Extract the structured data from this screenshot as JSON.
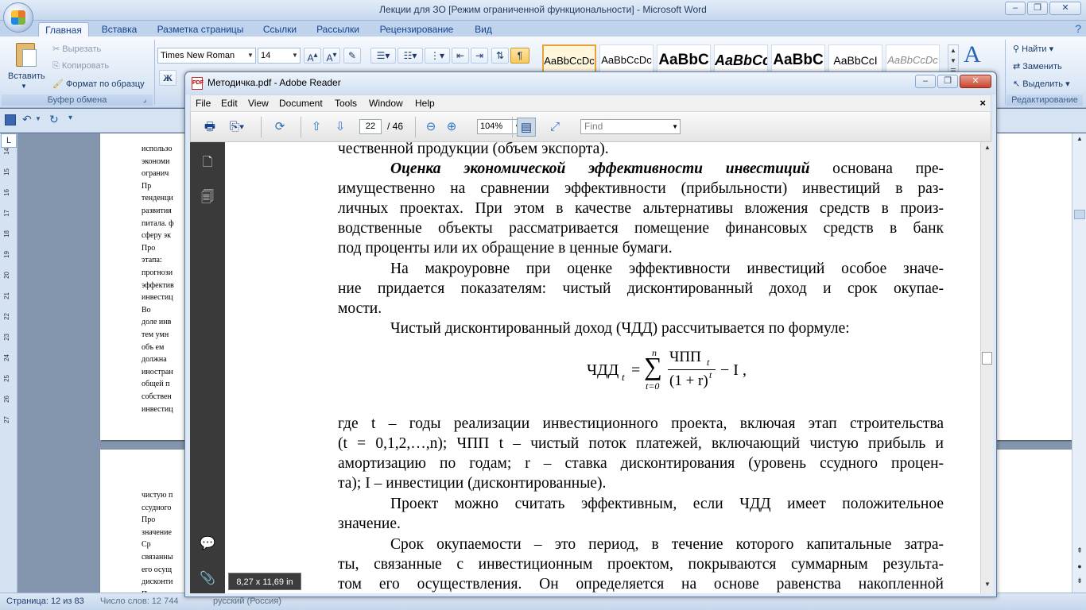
{
  "word": {
    "title": "Лекции для ЗО [Режим ограниченной функциональности] - Microsoft Word",
    "tabs": [
      "Главная",
      "Вставка",
      "Разметка страницы",
      "Ссылки",
      "Рассылки",
      "Рецензирование",
      "Вид"
    ],
    "clipboard": {
      "paste": "Вставить",
      "cut": "Вырезать",
      "copy": "Копировать",
      "format_painter": "Формат по образцу",
      "group_label": "Буфер обмена"
    },
    "font": {
      "name": "Times New Roman",
      "size": "14"
    },
    "styles": [
      "AaBbCcDc",
      "AaBbCcDc",
      "AaBbC",
      "AaBbCc",
      "AaBbC",
      "AaBbCcI",
      "AaBbCcDc"
    ],
    "editing": {
      "find": "Найти",
      "replace": "Заменить",
      "select": "Выделить",
      "group_label": "Редактирование"
    },
    "ruler_numbers": [
      "14",
      "15",
      "16",
      "17",
      "18",
      "19",
      "20",
      "21",
      "22",
      "23",
      "24",
      "25",
      "26",
      "27"
    ],
    "page1_lines": [
      "использо",
      "экономи",
      "огранич",
      "Пр",
      "тенденци",
      "развития",
      "питала. ф",
      "сферу эк",
      "Про",
      "этапа:",
      "прогнози",
      "эффектив",
      "инвестиц",
      "Во",
      "доле инв",
      "тем умн",
      "объ ем",
      "должна",
      "иностран",
      "общей п",
      "собствен",
      "инвестиц"
    ],
    "page2_lines": [
      "чистую п",
      "ссудного",
      "Про",
      "значение",
      "Ср",
      "связанны",
      "его осущ",
      "дисконти",
      "П"
    ],
    "status": {
      "page": "Страница: 12 из 83",
      "words": "Число слов: 12 744",
      "lang": "русский (Россия)"
    }
  },
  "reader": {
    "title": "Методичка.pdf - Adobe Reader",
    "menu": [
      "File",
      "Edit",
      "View",
      "Document",
      "Tools",
      "Window",
      "Help"
    ],
    "page_current": "22",
    "page_total": "/ 46",
    "zoom": "104%",
    "find_placeholder": "Find",
    "page_size": "8,27 x 11,69 in",
    "text": {
      "l0": "чественной продукции (объем экспорта).",
      "l1_bold": "Оценка экономической эффективности инвестиций",
      "l1_rest": " основана пре-",
      "l2": "имущественно на сравнении эффективности (прибыльности) инвестиций в раз-",
      "l3": "личных проектах. При этом в качестве альтернативы вложения средств в произ-",
      "l4": "водственные объекты рассматривается помещение финансовых средств в банк",
      "l5": "под проценты или их обращение в ценные бумаги.",
      "l6": "На макроуровне при оценке эффективности инвестиций особое значе-",
      "l7": "ние придается показателям: чистый дисконтированный доход и срок окупае-",
      "l8": "мости.",
      "l9": "Чистый дисконтированный доход (ЧДД) рассчитывается по формуле:",
      "f_lhs": "ЧДД",
      "f_sub": "t",
      "f_eq": "=",
      "f_top": "n",
      "f_sigma": "∑",
      "f_bot": "t=0",
      "f_num": "ЧПП",
      "f_num_sub": "t",
      "f_den": "(1 + r)",
      "f_den_sup": "t",
      "f_tail": "− I ,",
      "l10": "где t – годы реализации инвестиционного проекта, включая этап строительства",
      "l11": "(t = 0,1,2,…,n); ЧПП t – чистый поток платежей, включающий чистую прибыль и",
      "l12": "амортизацию по годам; r – ставка дисконтирования (уровень ссудного процен-",
      "l13": "та); I – инвестиции (дисконтированные).",
      "l14": "Проект можно считать эффективным, если ЧДД имеет положительное",
      "l15": "значение.",
      "l16": "Срок окупаемости – это период, в течение которого капитальные затра-",
      "l17": "ты, связанные с инвестиционным проектом, покрываются суммарным результа-",
      "l18": "том его осуществления. Он определяется на основе равенства накопленной"
    }
  }
}
